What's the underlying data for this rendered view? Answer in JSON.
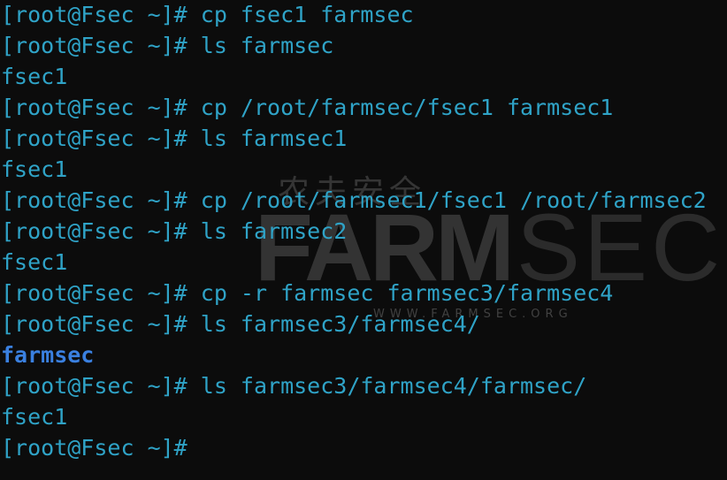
{
  "colors": {
    "background": "#0c0c0c",
    "text": "#2fa3c7",
    "directory": "#3a80e0"
  },
  "watermark": {
    "cn": "农夫安全",
    "farm": "FARM",
    "sec": "SEC",
    "url": "WWW.FARMSEC.ORG"
  },
  "terminal": {
    "lines": [
      {
        "text": "[root@Fsec ~]# cp fsec1 farmsec",
        "type": "command"
      },
      {
        "text": "[root@Fsec ~]# ls farmsec",
        "type": "command"
      },
      {
        "text": "fsec1",
        "type": "output"
      },
      {
        "text": "[root@Fsec ~]# cp /root/farmsec/fsec1 farmsec1",
        "type": "command"
      },
      {
        "text": "[root@Fsec ~]# ls farmsec1",
        "type": "command"
      },
      {
        "text": "fsec1",
        "type": "output"
      },
      {
        "text": "[root@Fsec ~]# cp /root/farmsec1/fsec1 /root/farmsec2",
        "type": "command"
      },
      {
        "text": "[root@Fsec ~]# ls farmsec2",
        "type": "command"
      },
      {
        "text": "fsec1",
        "type": "output"
      },
      {
        "text": "[root@Fsec ~]# cp -r farmsec farmsec3/farmsec4",
        "type": "command"
      },
      {
        "text": "[root@Fsec ~]# ls farmsec3/farmsec4/",
        "type": "command"
      },
      {
        "text": "farmsec",
        "type": "directory"
      },
      {
        "text": "[root@Fsec ~]# ls farmsec3/farmsec4/farmsec/",
        "type": "command"
      },
      {
        "text": "fsec1",
        "type": "output"
      },
      {
        "text": "[root@Fsec ~]#",
        "type": "prompt"
      }
    ]
  }
}
